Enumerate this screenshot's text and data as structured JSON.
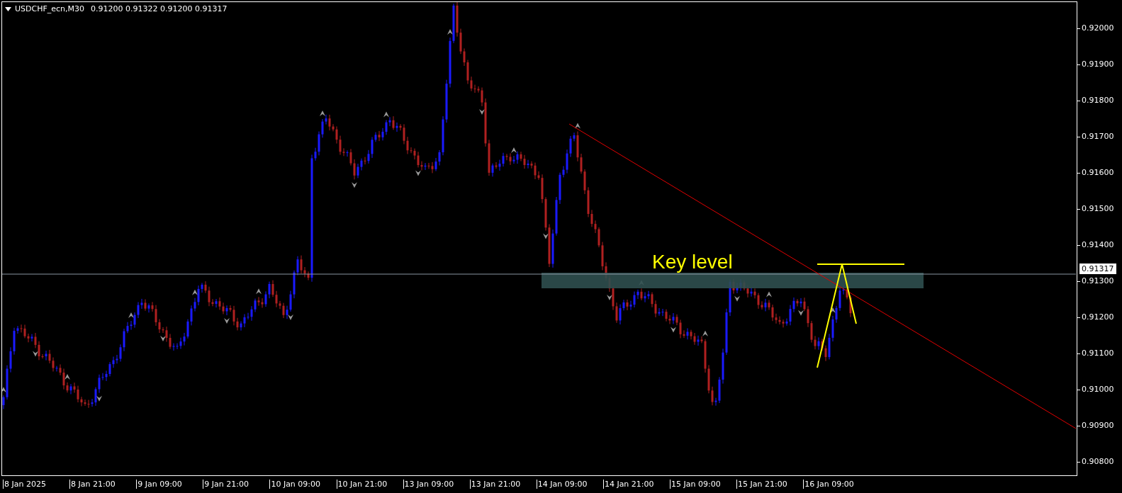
{
  "chart_header": {
    "symbol": "USDCHF_ecn,M30",
    "quote": "0.91200 0.91322 0.91200 0.91317"
  },
  "price_axis": [
    "0.92000",
    "0.91900",
    "0.91800",
    "0.91700",
    "0.91600",
    "0.91500",
    "0.91400",
    "0.91300",
    "0.91200",
    "0.91100",
    "0.91000",
    "0.90900",
    "0.90800"
  ],
  "current_price": "0.91317",
  "time_axis": [
    "8 Jan 2025",
    "8 Jan 21:00",
    "9 Jan 09:00",
    "9 Jan 21:00",
    "10 Jan 09:00",
    "10 Jan 21:00",
    "13 Jan 09:00",
    "13 Jan 21:00",
    "14 Jan 09:00",
    "14 Jan 21:00",
    "15 Jan 09:00",
    "15 Jan 21:00",
    "16 Jan 09:00"
  ],
  "annotation": {
    "text": "Key level"
  }
}
